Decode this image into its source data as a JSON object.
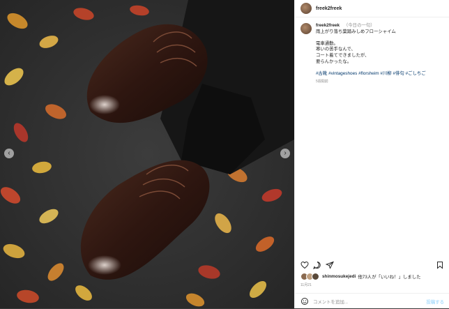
{
  "post": {
    "username": "freek2freek",
    "caption_date": "（今日の一句）",
    "caption_lines": [
      "雨上がり落ち葉踏みしめフローシャイム",
      "",
      "電車通勤。",
      "寒いの苦手なんで、",
      "コート着てできましたが、",
      "要らんかったな。"
    ],
    "hashtags": "#古靴 #vintageshoes #florsheim #川柳 #俳句 #ごしちご",
    "posted_ago": "5週間前",
    "liked_by_user": "shinmosukejedi",
    "likes_suffix": "他73人が「いいね！」しました",
    "date": "11月21",
    "comment_placeholder": "コメントを追加...",
    "post_button": "投稿する"
  },
  "icons": [
    "heart-icon",
    "comment-icon",
    "share-icon",
    "bookmark-icon",
    "emoji-icon",
    "chevron-left-icon",
    "chevron-right-icon"
  ],
  "colors": {
    "link": "#00376b",
    "muted": "#8e8e8e",
    "post_button": "#b2dffc"
  }
}
